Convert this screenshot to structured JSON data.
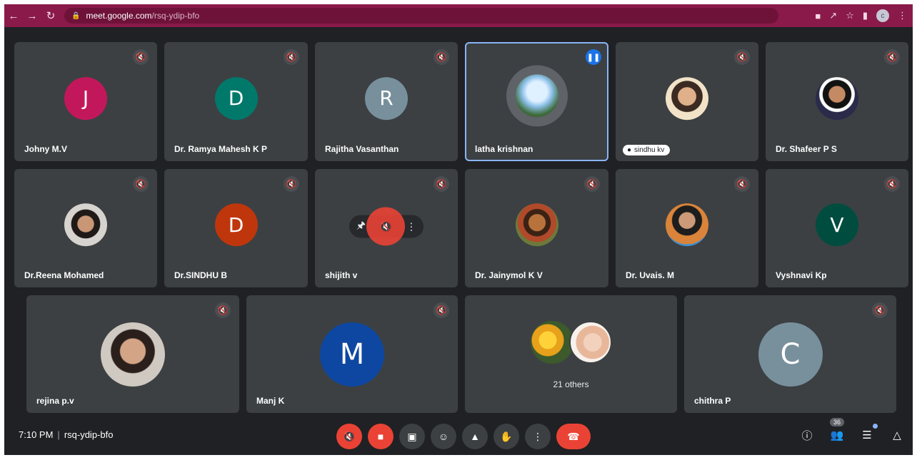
{
  "browser": {
    "url_domain": "meet.google.com",
    "url_path": "/rsq-ydip-bfo",
    "profile_initial": "c",
    "icons": [
      "back-icon",
      "forward-icon",
      "reload-icon",
      "lock-icon",
      "camera-icon",
      "share-icon",
      "star-icon",
      "sidepanel-icon",
      "menu-icon"
    ]
  },
  "tiles": [
    {
      "name": "Johny M.V",
      "initial": "J",
      "color": "#c2185b"
    },
    {
      "name": "Dr. Ramya Mahesh K P",
      "initial": "D",
      "color": "#00796b"
    },
    {
      "name": "Rajitha Vasanthan",
      "initial": "R",
      "color": "#78909c"
    },
    {
      "name": "latha krishnan"
    },
    {
      "name": "sindhu kv"
    },
    {
      "name": "Dr. Shafeer P S"
    },
    {
      "name": "Dr.Reena Mohamed"
    },
    {
      "name": "Dr.SINDHU B",
      "initial": "D",
      "color": "#bf360c"
    },
    {
      "name": "shijith v"
    },
    {
      "name": "Dr. Jainymol K V"
    },
    {
      "name": "Dr. Uvais. M"
    },
    {
      "name": "Vyshnavi Kp",
      "initial": "V",
      "color": "#004d40"
    },
    {
      "name": "rejina p.v"
    },
    {
      "name": "Manj K",
      "initial": "M",
      "color": "#0d47a1"
    },
    {
      "name": "21 others"
    },
    {
      "name": "chithra P",
      "initial": "C",
      "color": "#78909c"
    }
  ],
  "footer": {
    "time": "7:10 PM",
    "separator": "|",
    "meeting_code": "rsq-ydip-bfo",
    "participant_count": "36"
  }
}
